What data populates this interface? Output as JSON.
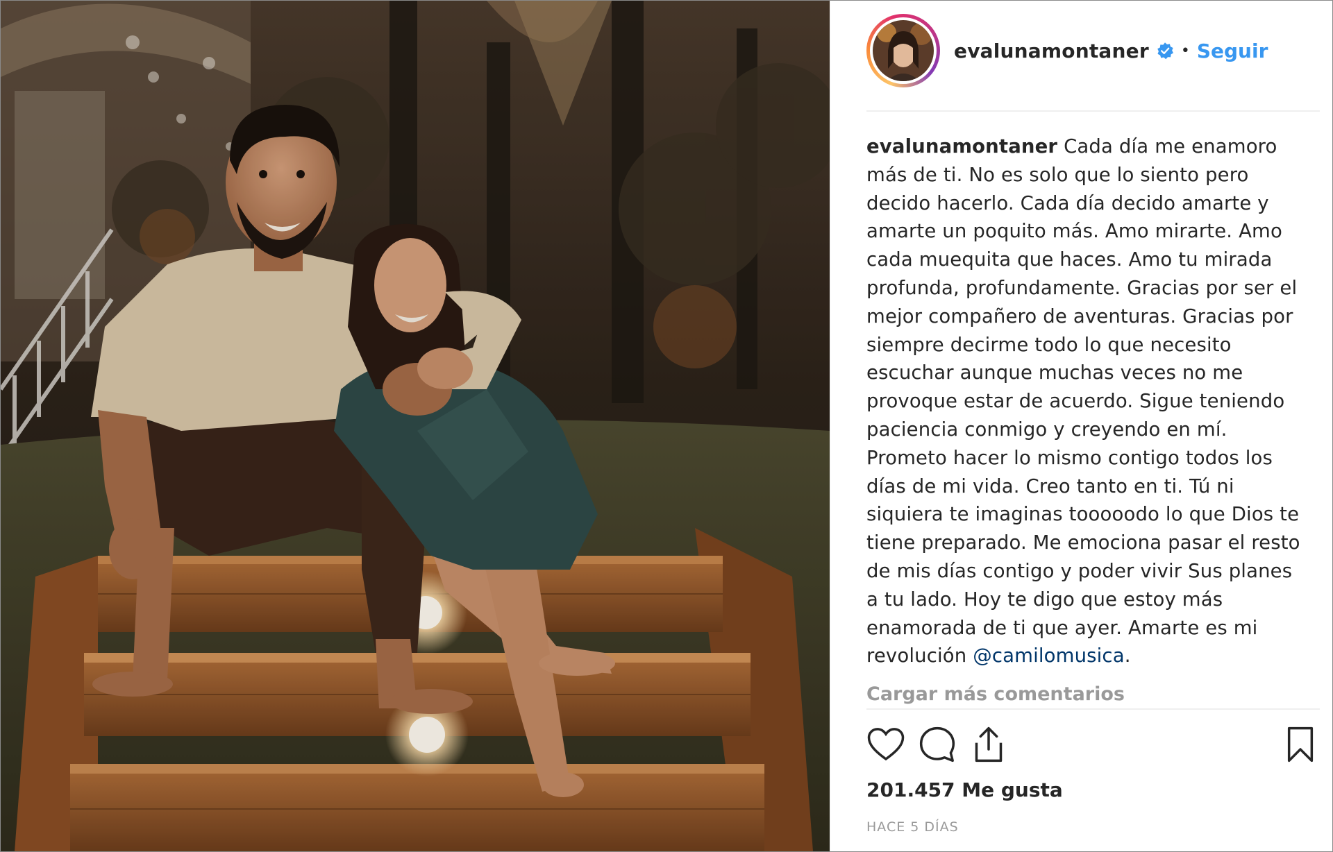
{
  "photo": {
    "alt_subject": "couple-sitting-on-wooden-steps"
  },
  "header": {
    "username": "evalunamontaner",
    "separator": "•",
    "follow_label": "Seguir"
  },
  "caption": {
    "username": "evalunamontaner",
    "text": "Cada día me enamoro más de ti. No es solo que lo siento pero decido hacerlo. Cada día decido amarte y amarte un poquito más. Amo mirarte. Amo cada muequita que haces. Amo tu mirada profunda, profundamente. Gracias por ser el mejor compañero de aventuras. Gracias por siempre decirme todo lo que necesito escuchar aunque muchas veces no me provoque estar de acuerdo. Sigue teniendo paciencia conmigo y creyendo en mí. Prometo hacer lo mismo contigo todos los días de mi vida. Creo tanto en ti. Tú ni siquiera te imaginas tooooodo lo que Dios te tiene preparado. Me emociona pasar el resto de mis días contigo y poder vivir Sus planes a tu lado. Hoy te digo que estoy más enamorada de ti que ayer. Amarte es mi revolución",
    "mention": "@camilomusica",
    "trailing": "."
  },
  "load_more_label": "Cargar más comentarios",
  "likes_label": "201.457 Me gusta",
  "timestamp": "HACE 5 DÍAS",
  "icons": {
    "like": "heart-icon",
    "comment": "comment-icon",
    "share": "share-icon",
    "save": "bookmark-icon",
    "verified": "verified-badge-icon"
  },
  "colors": {
    "link_blue": "#3897f0",
    "mention": "#003569",
    "muted": "#999999",
    "text": "#262626"
  }
}
